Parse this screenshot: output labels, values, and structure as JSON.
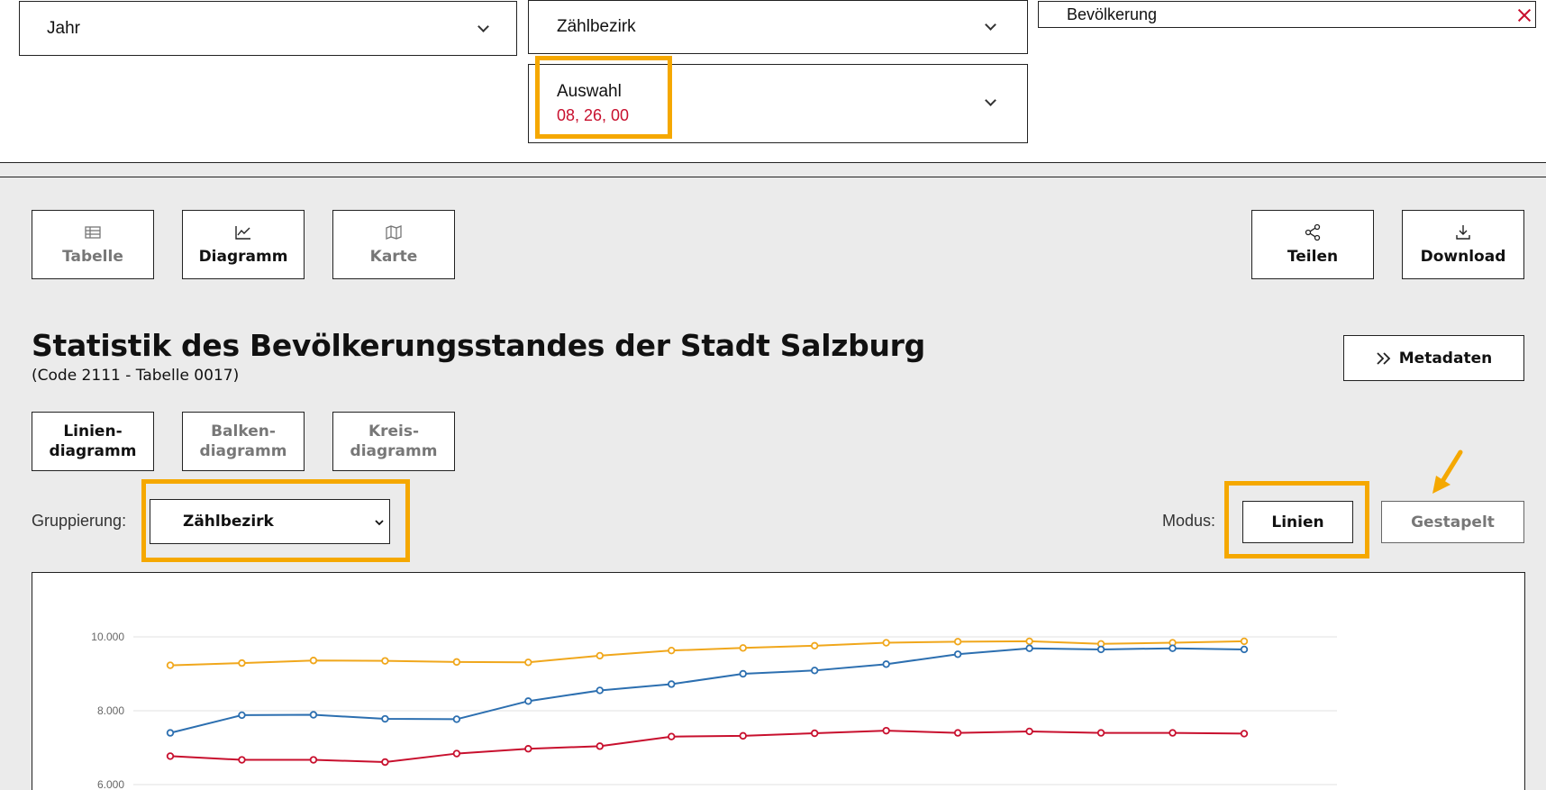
{
  "filters": {
    "year_label": "Jahr",
    "district_label": "Zählbezirk",
    "topic_value": "Bevölkerung",
    "selection_label": "Auswahl",
    "selection_value": "08, 26, 00"
  },
  "view_tabs": {
    "table": "Tabelle",
    "chart": "Diagramm",
    "map": "Karte",
    "share": "Teilen",
    "download": "Download"
  },
  "page": {
    "title": "Statistik des Bevölkerungsstandes der Stadt Salzburg",
    "subtitle": "(Code 2111 - Tabelle 0017)",
    "metadata_button": "Metadaten"
  },
  "chart_types": {
    "line": "Linien-\ndiagramm",
    "bar": "Balken-\ndiagramm",
    "pie": "Kreis-\ndiagramm"
  },
  "grouping": {
    "label": "Gruppierung:",
    "value": "Zählbezirk"
  },
  "mode": {
    "label": "Modus:",
    "lines": "Linien",
    "stacked": "Gestapelt"
  },
  "colors": {
    "accent": "#f5a800",
    "selection_text": "#c8102e",
    "series_orange": "#f0a71c",
    "series_blue": "#2c6fb0",
    "series_red": "#c8102e"
  },
  "chart_data": {
    "type": "line",
    "ylim": [
      6000,
      10500
    ],
    "yticks": [
      6000,
      8000,
      10000
    ],
    "ytick_labels": [
      "6.000",
      "8.000",
      "10.000"
    ],
    "point_count": 16,
    "series": [
      {
        "color": "#f0a71c",
        "values": [
          9230,
          9290,
          9360,
          9350,
          9320,
          9310,
          9490,
          9630,
          9700,
          9760,
          9840,
          9870,
          9880,
          9810,
          9840,
          9880
        ]
      },
      {
        "color": "#2c6fb0",
        "values": [
          7400,
          7880,
          7890,
          7780,
          7770,
          8260,
          8550,
          8720,
          9000,
          9090,
          9260,
          9530,
          9690,
          9660,
          9690,
          9660
        ]
      },
      {
        "color": "#c8102e",
        "values": [
          6770,
          6670,
          6670,
          6610,
          6840,
          6970,
          7040,
          7300,
          7320,
          7390,
          7460,
          7400,
          7440,
          7400,
          7400,
          7380
        ]
      }
    ]
  }
}
